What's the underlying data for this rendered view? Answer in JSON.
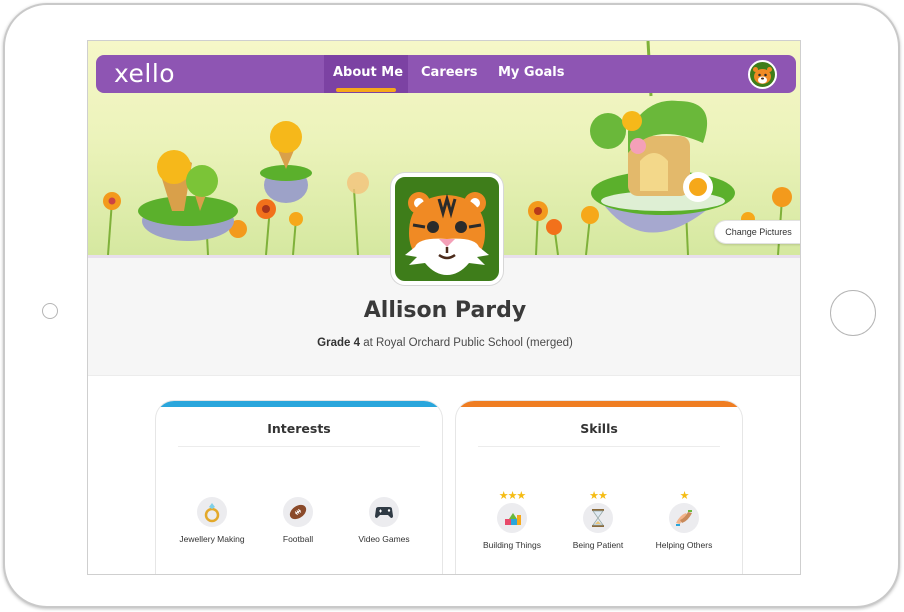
{
  "app": {
    "logo": "xello"
  },
  "nav": {
    "items": [
      {
        "label": "About Me",
        "active": true
      },
      {
        "label": "Careers",
        "active": false
      },
      {
        "label": "My Goals",
        "active": false
      }
    ]
  },
  "banner": {
    "change_pictures": "Change Pictures"
  },
  "profile": {
    "name": "Allison Pardy",
    "grade": "Grade 4",
    "school": "at Royal Orchard Public School (merged)"
  },
  "interests": {
    "title": "Interests",
    "items": [
      {
        "label": "Jewellery Making",
        "icon": "ring-icon"
      },
      {
        "label": "Football",
        "icon": "football-icon"
      },
      {
        "label": "Video Games",
        "icon": "gamepad-icon"
      }
    ]
  },
  "skills": {
    "title": "Skills",
    "items": [
      {
        "label": "Building Things",
        "icon": "blocks-icon",
        "stars": 3
      },
      {
        "label": "Being Patient",
        "icon": "hourglass-icon",
        "stars": 2
      },
      {
        "label": "Helping Others",
        "icon": "helping-hands-icon",
        "stars": 1
      }
    ]
  },
  "colors": {
    "nav_bg": "#8e55b3",
    "nav_accent": "#f6a81a",
    "interests_accent": "#2aa6dc",
    "skills_accent": "#ef7d22",
    "avatar_bg": "#3e7d1a"
  }
}
